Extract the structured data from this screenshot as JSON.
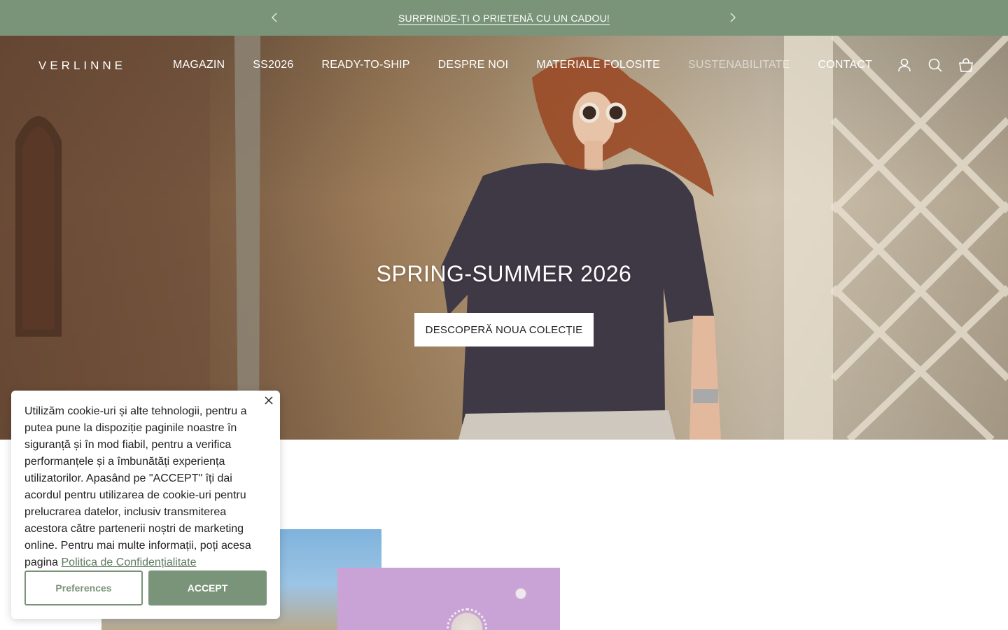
{
  "announcement": {
    "text": "SURPRINDE-ȚI O PRIETENĂ CU UN CADOU!",
    "prev_icon": "chevron-left-icon",
    "next_icon": "chevron-right-icon"
  },
  "header": {
    "logo": "VERLINNE",
    "nav": [
      {
        "label": "MAGAZIN"
      },
      {
        "label": "SS2026"
      },
      {
        "label": "READY-TO-SHIP"
      },
      {
        "label": "DESPRE NOI"
      },
      {
        "label": "MATERIALE FOLOSITE"
      },
      {
        "label": "SUSTENABILITATE"
      },
      {
        "label": "CONTACT"
      }
    ],
    "icons": [
      "account-icon",
      "search-icon",
      "cart-icon"
    ]
  },
  "hero": {
    "title": "SPRING-SUMMER 2026",
    "cta": "DESCOPERĂ NOUA COLECȚIE"
  },
  "cookie": {
    "text": "Utilizăm cookie-uri și alte tehnologii, pentru a putea pune la dispoziție paginile noastre în siguranță și în mod fiabil, pentru a verifica performanțele și a îmbunătăți experiența utilizatorilor. Apasând pe \"ACCEPT\" îți dai acordul pentru utilizarea de cookie-uri pentru prelucrarea datelor, inclusiv transmiterea acestora către partenerii noștri de marketing online. Pentru mai multe informații, poți acesa pagina",
    "link": "Politica de Confidențialitate",
    "preferences": "Preferences",
    "accept": "ACCEPT"
  },
  "colors": {
    "brand_green": "#7a9479"
  }
}
